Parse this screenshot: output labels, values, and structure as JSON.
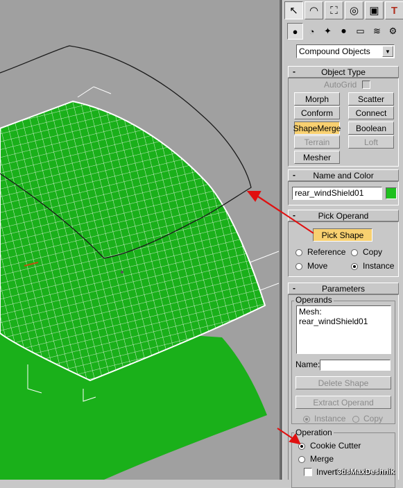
{
  "command_panel": {
    "tabs": [
      {
        "name": "create-tab",
        "icon": "pointer-star-icon",
        "glyph": "↖"
      },
      {
        "name": "modify-tab",
        "icon": "bend-arc-icon",
        "glyph": "◠"
      },
      {
        "name": "hierarchy-tab",
        "icon": "hierarchy-icon",
        "glyph": "⛶"
      },
      {
        "name": "motion-tab",
        "icon": "motion-wheel-icon",
        "glyph": "◎"
      },
      {
        "name": "display-tab",
        "icon": "monitor-icon",
        "glyph": "▣"
      },
      {
        "name": "utilities-tab",
        "icon": "hammer-icon",
        "glyph": "T"
      }
    ],
    "subtabs": [
      {
        "name": "geometry-subtab",
        "icon": "sphere-icon",
        "glyph": "●"
      },
      {
        "name": "shapes-subtab",
        "icon": "shapes-icon",
        "glyph": "◔"
      },
      {
        "name": "lights-subtab",
        "icon": "light-icon",
        "glyph": "✦"
      },
      {
        "name": "cameras-subtab",
        "icon": "camera-icon",
        "glyph": "⏺"
      },
      {
        "name": "helpers-subtab",
        "icon": "helper-icon",
        "glyph": "▭"
      },
      {
        "name": "spacewarps-subtab",
        "icon": "wave-icon",
        "glyph": "≋"
      },
      {
        "name": "systems-subtab",
        "icon": "gears-icon",
        "glyph": "⚙"
      }
    ],
    "category_dropdown": "Compound Objects"
  },
  "object_type": {
    "title": "Object Type",
    "autogrid_label": "AutoGrid",
    "buttons": [
      "Morph",
      "Scatter",
      "Conform",
      "Connect",
      "ShapeMerge",
      "Boolean",
      "Terrain",
      "Loft",
      "Mesher"
    ]
  },
  "name_and_color": {
    "title": "Name and Color",
    "object_name": "rear_windShield01",
    "color": "#1ec01e"
  },
  "pick_operand": {
    "title": "Pick Operand",
    "pick_button": "Pick Shape",
    "reference_label": "Reference",
    "copy_label": "Copy",
    "move_label": "Move",
    "instance_label": "Instance"
  },
  "parameters": {
    "title": "Parameters",
    "operands_label": "Operands",
    "operands_item": "Mesh: rear_windShield01",
    "name_label": "Name:",
    "name_value": "",
    "delete_shape": "Delete Shape",
    "extract_operand": "Extract Operand",
    "instance_label": "Instance",
    "copy_label": "Copy",
    "operation_label": "Operation",
    "cookie_cutter_label": "Cookie Cutter",
    "merge_label": "Merge",
    "invert_label": "Invert"
  },
  "watermark": "3dsMaxDeshnik",
  "colors": {
    "viewport_bg": "#a0a0a0",
    "mesh_green": "#1ab01a",
    "active_button": "#f8d070",
    "arrow_red": "#e01010"
  }
}
